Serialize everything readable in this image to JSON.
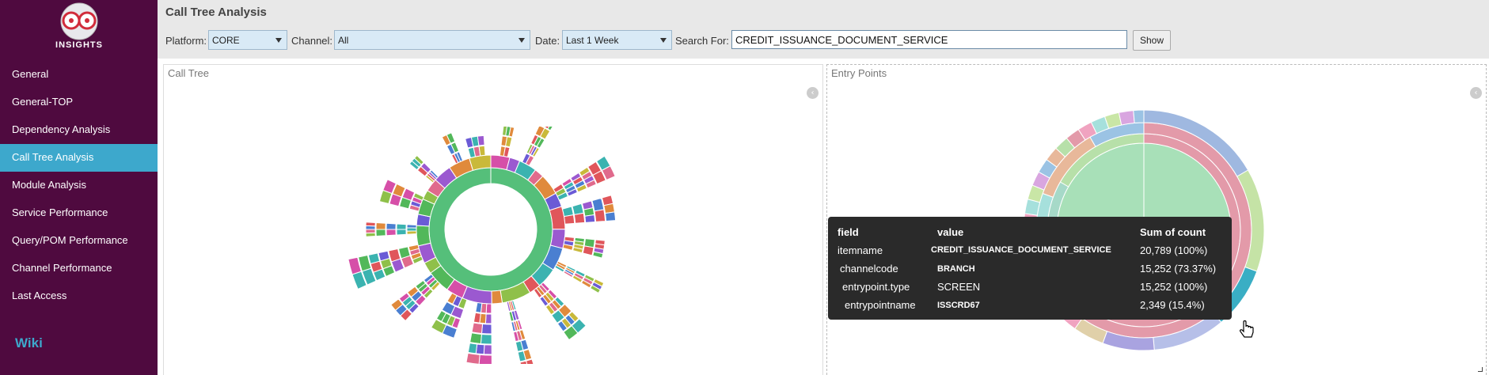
{
  "app": {
    "logo_text": "INSIGHTS"
  },
  "sidebar": {
    "items": [
      {
        "label": "General"
      },
      {
        "label": "General-TOP"
      },
      {
        "label": "Dependency Analysis"
      },
      {
        "label": "Call Tree Analysis",
        "active": true
      },
      {
        "label": "Module Analysis"
      },
      {
        "label": "Service Performance"
      },
      {
        "label": "Query/POM Performance"
      },
      {
        "label": "Channel Performance"
      },
      {
        "label": "Last Access"
      }
    ],
    "wiki": "Wiki"
  },
  "header": {
    "title": "Call Tree Analysis",
    "platform_label": "Platform:",
    "platform_value": "CORE",
    "channel_label": "Channel:",
    "channel_value": "All",
    "date_label": "Date:",
    "date_value": "Last 1 Week",
    "search_label": "Search For:",
    "search_value": "CREDIT_ISSUANCE_DOCUMENT_SERVICE",
    "show_label": "Show"
  },
  "panels": {
    "call_tree_title": "Call Tree",
    "entry_points_title": "Entry Points"
  },
  "tooltip": {
    "headers": [
      "field",
      "value",
      "Sum of count"
    ],
    "rows": [
      {
        "field": "itemname",
        "value": "CREDIT_ISSUANCE_DOCUMENT_SERVICE",
        "sum": "20,789 (100%)"
      },
      {
        "field": "channelcode",
        "value": "BRANCH",
        "sum": "15,252 (73.37%)"
      },
      {
        "field": "entrypoint.type",
        "value": "SCREEN",
        "sum": "15,252 (100%)"
      },
      {
        "field": "entrypointname",
        "value": "ISSCRD67",
        "sum": "2,349 (15.4%)"
      }
    ]
  },
  "colors": {
    "sidebar_bg": "#4f0a3f",
    "active_item": "#3da8cc",
    "wiki": "#3da8cc",
    "tree_core": "#55bf7a"
  }
}
